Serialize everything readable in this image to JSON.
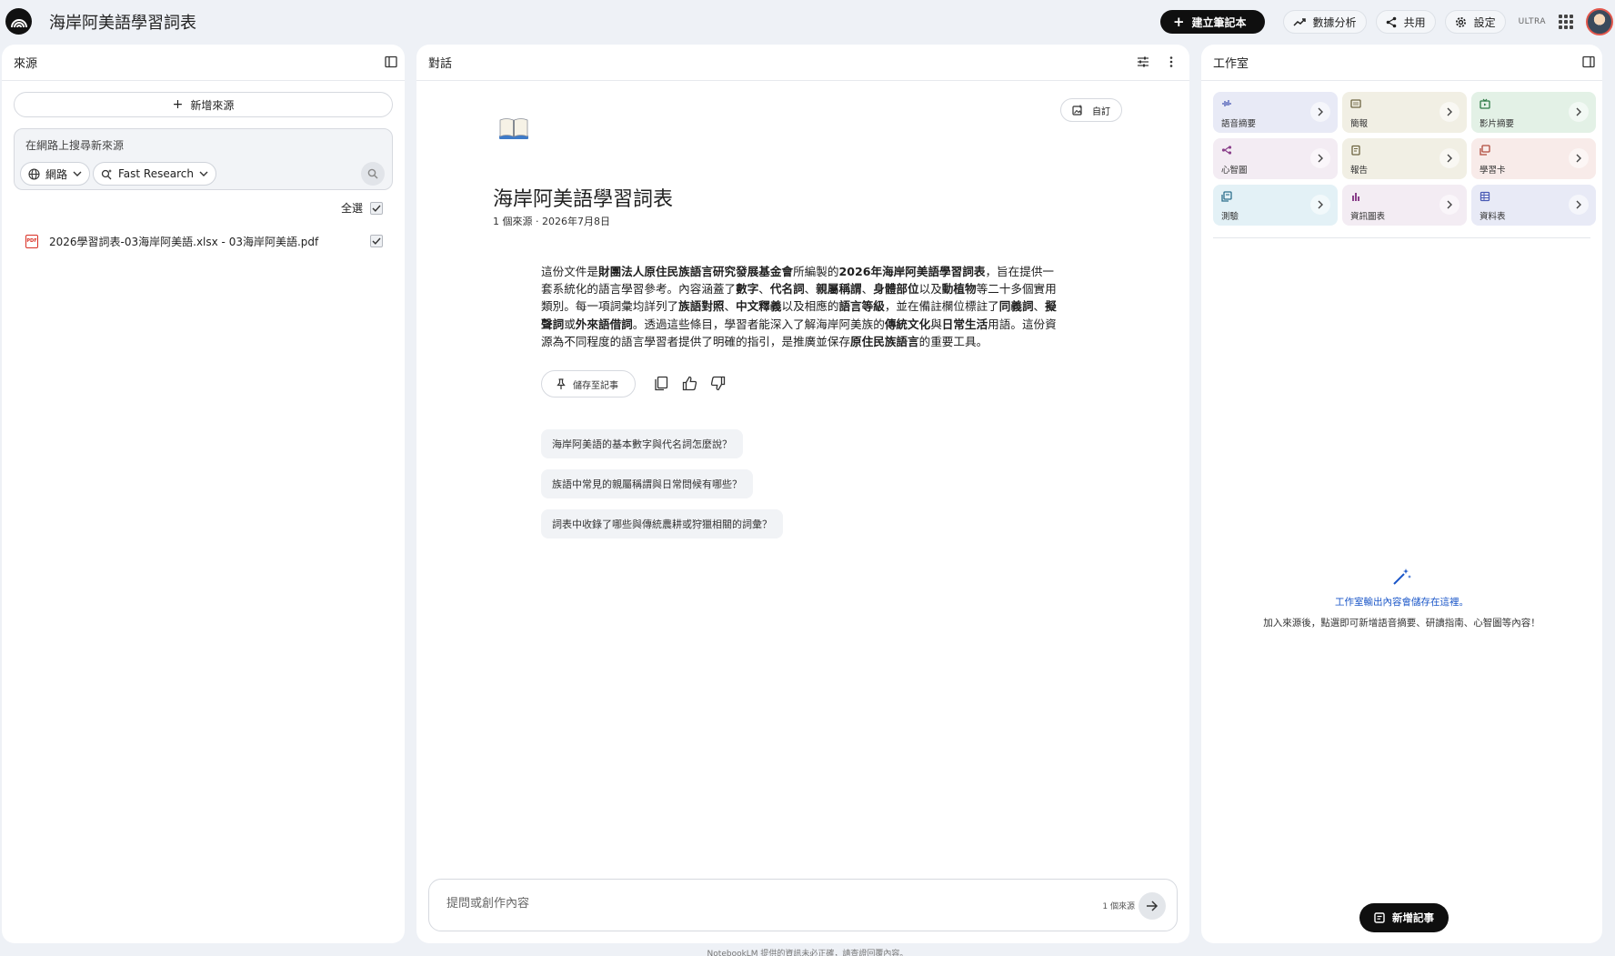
{
  "app": {
    "title": "海岸阿美語學習詞表"
  },
  "topbar": {
    "create_notebook": "建立筆記本",
    "analytics": "數據分析",
    "share": "共用",
    "settings": "設定",
    "plan_badge": "ULTRA"
  },
  "sources": {
    "header": "來源",
    "add_source": "新增來源",
    "web_search_placeholder": "在網路上搜尋新來源",
    "web_chip": "網路",
    "research_chip": "Fast Research",
    "select_all": "全選",
    "items": [
      {
        "name": "2026學習詞表-03海岸阿美語.xlsx - 03海岸阿美語.pdf",
        "type_badge": "PDF",
        "checked": true
      }
    ]
  },
  "chat": {
    "header": "對話",
    "customize": "自訂",
    "title": "海岸阿美語學習詞表",
    "meta": "1 個來源 · 2026年7月8日",
    "summary_segments": [
      {
        "t": "這份文件是",
        "b": false
      },
      {
        "t": "財團法人原住民族語言研究發展基金會",
        "b": true
      },
      {
        "t": "所編製的",
        "b": false
      },
      {
        "t": "2026年海岸阿美語學習詞表",
        "b": true
      },
      {
        "t": "，旨在提供一套系統化的語言學習參考。內容涵蓋了",
        "b": false
      },
      {
        "t": "數字",
        "b": true
      },
      {
        "t": "、",
        "b": false
      },
      {
        "t": "代名詞",
        "b": true
      },
      {
        "t": "、",
        "b": false
      },
      {
        "t": "親屬稱謂",
        "b": true
      },
      {
        "t": "、",
        "b": false
      },
      {
        "t": "身體部位",
        "b": true
      },
      {
        "t": "以及",
        "b": false
      },
      {
        "t": "動植物",
        "b": true
      },
      {
        "t": "等二十多個實用類別。每一項詞彙均詳列了",
        "b": false
      },
      {
        "t": "族語對照",
        "b": true
      },
      {
        "t": "、",
        "b": false
      },
      {
        "t": "中文釋義",
        "b": true
      },
      {
        "t": "以及相應的",
        "b": false
      },
      {
        "t": "語言等級",
        "b": true
      },
      {
        "t": "，並在備註欄位標註了",
        "b": false
      },
      {
        "t": "同義詞",
        "b": true
      },
      {
        "t": "、",
        "b": false
      },
      {
        "t": "擬聲詞",
        "b": true
      },
      {
        "t": "或",
        "b": false
      },
      {
        "t": "外來語借詞",
        "b": true
      },
      {
        "t": "。透過這些條目，學習者能深入了解海岸阿美族的",
        "b": false
      },
      {
        "t": "傳統文化",
        "b": true
      },
      {
        "t": "與",
        "b": false
      },
      {
        "t": "日常生活",
        "b": true
      },
      {
        "t": "用語。這份資源為不同程度的語言學習者提供了明確的指引，是推廣並保存",
        "b": false
      },
      {
        "t": "原住民族語言",
        "b": true
      },
      {
        "t": "的重要工具。",
        "b": false
      }
    ],
    "save_to_note": "儲存至記事",
    "suggestions": [
      "海岸阿美語的基本數字與代名詞怎麼說？",
      "族語中常見的親屬稱謂與日常問候有哪些？",
      "詞表中收錄了哪些與傳統農耕或狩獵相關的詞彙？"
    ],
    "input_placeholder": "提問或創作內容",
    "source_count": "1 個來源"
  },
  "studio": {
    "header": "工作室",
    "tiles": [
      {
        "label": "語音摘要",
        "icon": "audio-wave-icon",
        "bg": "#e8eaf6",
        "fg": "#4a5bb5"
      },
      {
        "label": "簡報",
        "icon": "slides-icon",
        "bg": "#f1efe4",
        "fg": "#6d6440"
      },
      {
        "label": "影片摘要",
        "icon": "video-icon",
        "bg": "#e3f1e6",
        "fg": "#2d7a45"
      },
      {
        "label": "心智圖",
        "icon": "mindmap-icon",
        "bg": "#f3ecf3",
        "fg": "#8a3f8a"
      },
      {
        "label": "報告",
        "icon": "report-icon",
        "bg": "#f1efe4",
        "fg": "#6d6440"
      },
      {
        "label": "學習卡",
        "icon": "flashcard-icon",
        "bg": "#f8ebe9",
        "fg": "#b04a3c"
      },
      {
        "label": "測驗",
        "icon": "quiz-icon",
        "bg": "#e3f1f6",
        "fg": "#2d6f8c"
      },
      {
        "label": "資訊圖表",
        "icon": "infographic-icon",
        "bg": "#f3ecf3",
        "fg": "#8a3f8a"
      },
      {
        "label": "資料表",
        "icon": "table-icon",
        "bg": "#e8eaf6",
        "fg": "#4a5bb5"
      }
    ],
    "empty_title": "工作室輸出內容會儲存在這裡。",
    "empty_desc": "加入來源後，點選即可新增語音摘要、研讀指南、心智圖等內容！",
    "new_note": "新增記事"
  },
  "footer": {
    "disclaimer": "NotebookLM 提供的資訊未必正確，請查證回覆內容。"
  }
}
